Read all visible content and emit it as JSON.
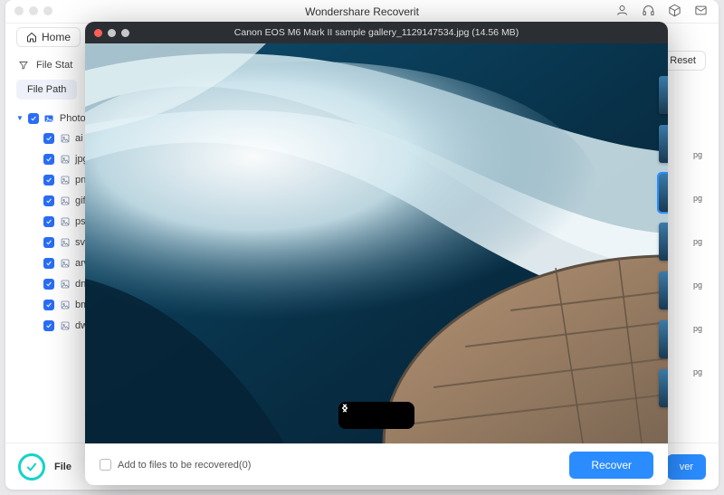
{
  "mainWindow": {
    "title": "Wondershare Recoverit",
    "homeLabel": "Home",
    "filterLabel": "File Stat",
    "tabs": {
      "filePath": "File Path"
    },
    "resetLabel": "Reset",
    "footerLabel": "File",
    "peekRecover": "ver",
    "tree": {
      "root": "Photo",
      "items": [
        "ai",
        "jpg",
        "pn",
        "gif",
        "ps",
        "svg",
        "arw",
        "dn",
        "bm",
        "dw"
      ]
    },
    "extTags": [
      "pg",
      "pg",
      "pg",
      "pg",
      "pg",
      "pg"
    ]
  },
  "preview": {
    "title": "Canon EOS M6 Mark II sample gallery_1129147534.jpg (14.56 MB)",
    "addLabel": "Add to files to be recovered(0)",
    "recoverLabel": "Recover"
  }
}
